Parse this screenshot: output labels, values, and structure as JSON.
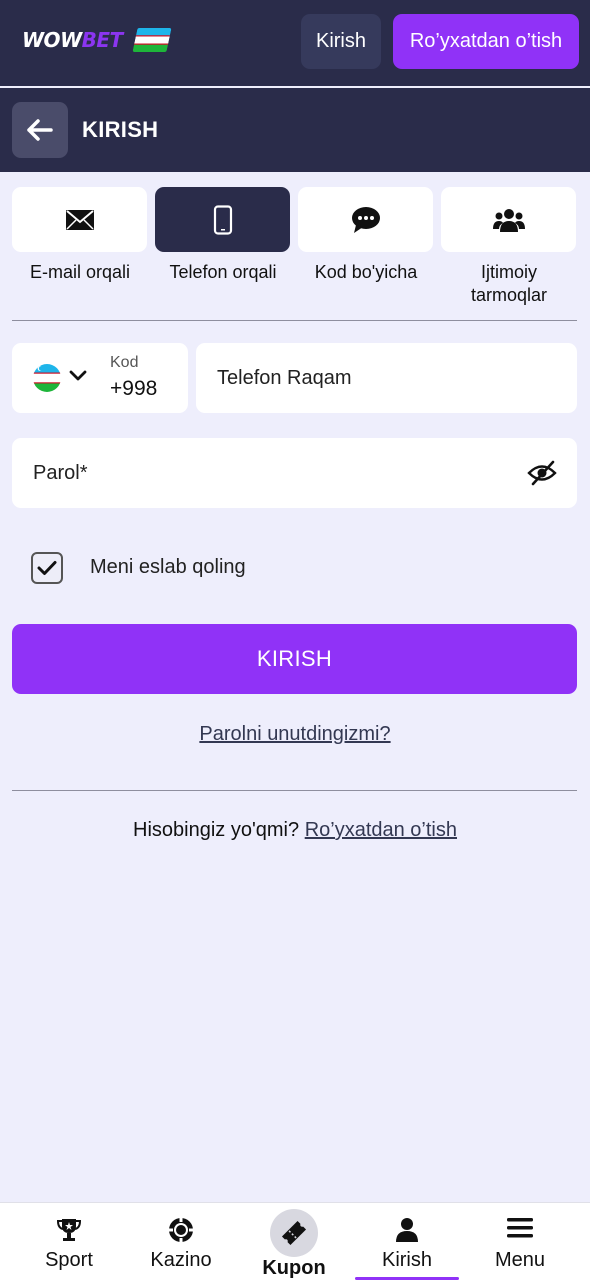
{
  "header": {
    "logo": {
      "part1": "WOW",
      "part2": "BET"
    },
    "login_label": "Kirish",
    "register_label": "Ro’yxatdan o’tish"
  },
  "titlebar": {
    "title": "KIRISH",
    "back_icon": "arrow-left-icon"
  },
  "methods": [
    {
      "label": "E-mail orqali",
      "icon": "envelope-icon",
      "active": false
    },
    {
      "label": "Telefon orqali",
      "icon": "smartphone-icon",
      "active": true
    },
    {
      "label": "Kod bo'yicha",
      "icon": "chat-bubble-icon",
      "active": false
    },
    {
      "label": "Ijtimoiy tarmoqlar",
      "icon": "users-icon",
      "active": false
    }
  ],
  "form": {
    "code_label": "Kod",
    "code_value": "+998",
    "phone_placeholder": "Telefon Raqam",
    "password_placeholder": "Parol*",
    "remember_label": "Meni eslab qoling",
    "remember_checked": true,
    "submit_label": "KIRISH",
    "forgot_label": "Parolni unutdingizmi?"
  },
  "signup": {
    "question": "Hisobingiz yo'qmi?",
    "link": "Ro’yxatdan o’tish"
  },
  "bottom_nav": [
    {
      "label": "Sport",
      "icon": "trophy-icon"
    },
    {
      "label": "Kazino",
      "icon": "casino-chip-icon"
    },
    {
      "label": "Kupon",
      "icon": "ticket-icon"
    },
    {
      "label": "Kirish",
      "icon": "user-icon"
    },
    {
      "label": "Menu",
      "icon": "menu-icon"
    }
  ],
  "colors": {
    "accent": "#9032f7",
    "header_bg": "#2a2c4a",
    "page_bg": "#eeeefc"
  }
}
